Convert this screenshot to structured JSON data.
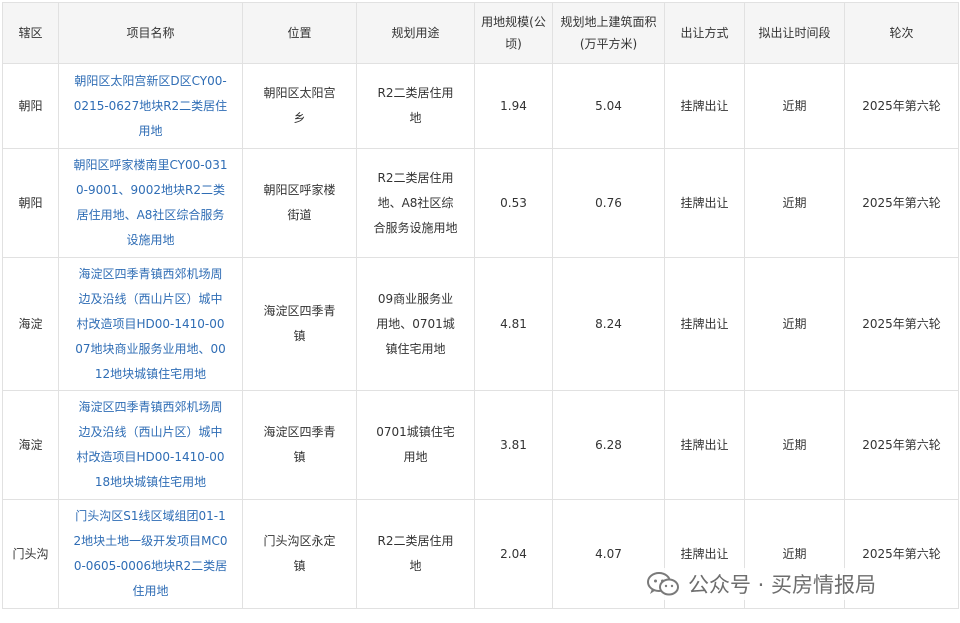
{
  "headers": {
    "district": "辖区",
    "project": "项目名称",
    "location": "位置",
    "usage": "规划用途",
    "area": "用地规模(公顷)",
    "floor": "规划地上建筑面积(万平方米)",
    "method": "出让方式",
    "period": "拟出让时间段",
    "round": "轮次"
  },
  "rows": [
    {
      "district": "朝阳",
      "project": "朝阳区太阳宫新区D区CY00-0215-0627地块R2二类居住用地",
      "location": "朝阳区太阳宫乡",
      "usage": "R2二类居住用地",
      "area": "1.94",
      "floor": "5.04",
      "method": "挂牌出让",
      "period": "近期",
      "round": "2025年第六轮"
    },
    {
      "district": "朝阳",
      "project": "朝阳区呼家楼南里CY00-0310-9001、9002地块R2二类居住用地、A8社区综合服务设施用地",
      "location": "朝阳区呼家楼街道",
      "usage": "R2二类居住用地、A8社区综合服务设施用地",
      "area": "0.53",
      "floor": "0.76",
      "method": "挂牌出让",
      "period": "近期",
      "round": "2025年第六轮"
    },
    {
      "district": "海淀",
      "project": "海淀区四季青镇西郊机场周边及沿线（西山片区）城中村改造项目HD00-1410-0007地块商业服务业用地、0012地块城镇住宅用地",
      "location": "海淀区四季青镇",
      "usage": "09商业服务业用地、0701城镇住宅用地",
      "area": "4.81",
      "floor": "8.24",
      "method": "挂牌出让",
      "period": "近期",
      "round": "2025年第六轮"
    },
    {
      "district": "海淀",
      "project": "海淀区四季青镇西郊机场周边及沿线（西山片区）城中村改造项目HD00-1410-0018地块城镇住宅用地",
      "location": "海淀区四季青镇",
      "usage": "0701城镇住宅用地",
      "area": "3.81",
      "floor": "6.28",
      "method": "挂牌出让",
      "period": "近期",
      "round": "2025年第六轮"
    },
    {
      "district": "门头沟",
      "project": "门头沟区S1线区域组团01-12地块土地一级开发项目MC00-0605-0006地块R2二类居住用地",
      "location": "门头沟区永定镇",
      "usage": "R2二类居住用地",
      "area": "2.04",
      "floor": "4.07",
      "method": "挂牌出让",
      "period": "近期",
      "round": "2025年第六轮"
    }
  ],
  "watermark": {
    "text": "公众号 · 买房情报局",
    "icon": "wechat-icon"
  }
}
